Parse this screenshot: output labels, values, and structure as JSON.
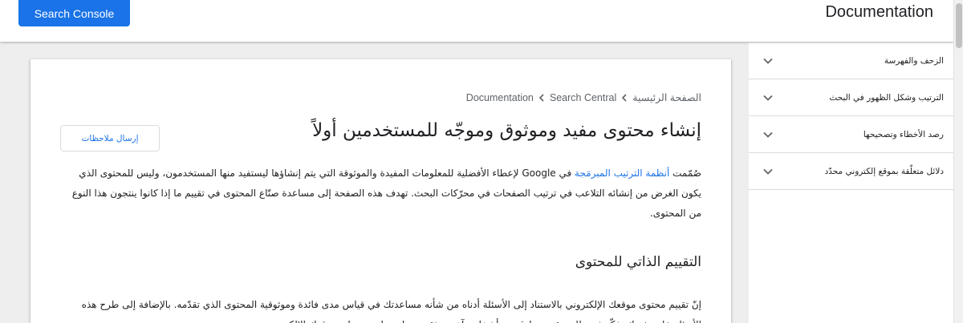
{
  "header": {
    "search_console_label": "Search Console",
    "site_title": "Documentation"
  },
  "sidebar": {
    "items": [
      {
        "label": "الزحف والفهرسة"
      },
      {
        "label": "الترتيب وشكل الظهور في البحث"
      },
      {
        "label": "رصد الأخطاء وتصحيحها"
      },
      {
        "label": "دلائل متعلّقة بموقع إلكتروني محدّد"
      }
    ]
  },
  "breadcrumb": {
    "items": [
      "الصفحة الرئيسية",
      "Search Central",
      "Documentation"
    ]
  },
  "page": {
    "title": "إنشاء محتوى مفيد وموثوق وموجّه للمستخدمين أولاً",
    "feedback_label": "إرسال ملاحظات",
    "intro_before_link": "صُمّمت ",
    "intro_link": "أنظمة الترتيب المبرمَجة",
    "intro_after_link": " في Google لإعطاء الأفضلية للمعلومات المفيدة والموثوقة التي يتم إنشاؤها ليستفيد منها المستخدمون، وليس للمحتوى الذي يكون الغرض من إنشائه التلاعب في ترتيب الصفحات في محرّكات البحث. تهدف هذه الصفحة إلى مساعدة صنّاع المحتوى في تقييم ما إذا كانوا ينتجون هذا النوع من المحتوى.",
    "section_title": "التقييم الذاتي للمحتوى",
    "section_body": "إنّ تقييم محتوى موقعك الإلكتروني بالاستناد إلى الأسئلة أدناه من شأنه مساعدتك في قياس مدى فائدة وموثوقية المحتوى الذي تقدّمه. بالإضافة إلى طرح هذه الأسئلة على نفسك، فكّر في طلب تقييم صادق من أشخاص آخرين ثقة بهم ليس لديهم صلة بموقعك الإلكتروني."
  },
  "colors": {
    "accent": "#1a73e8",
    "text": "#202124",
    "muted": "#5f6368",
    "background": "#eeeeee"
  },
  "icons": {
    "sidebar_chevron": "chevron-down-icon",
    "breadcrumb_separator": "chevron-left-icon"
  }
}
